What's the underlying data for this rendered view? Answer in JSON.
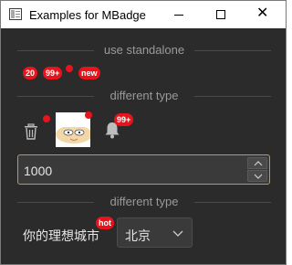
{
  "window": {
    "title": "Examples for MBadge",
    "buttons": {
      "minimize": "minimize",
      "maximize": "maximize",
      "close": "✕"
    }
  },
  "sections": [
    {
      "label": "use standalone"
    },
    {
      "label": "different type"
    },
    {
      "label": "different type"
    }
  ],
  "standalone": {
    "badges": [
      "20",
      "99+",
      "new"
    ]
  },
  "types": {
    "bell_badge": "99+"
  },
  "spinner": {
    "value": "1000"
  },
  "city": {
    "label": "你的理想城市",
    "badge": "hot",
    "selected": "北京"
  },
  "colors": {
    "badge_red": "#e8141c",
    "focus_orange": "#e08a3c",
    "background": "#2b2b2b"
  },
  "icons": [
    "app-icon",
    "trash-icon",
    "avatar-image",
    "bell-icon",
    "chevron-up-icon",
    "chevron-down-icon"
  ]
}
